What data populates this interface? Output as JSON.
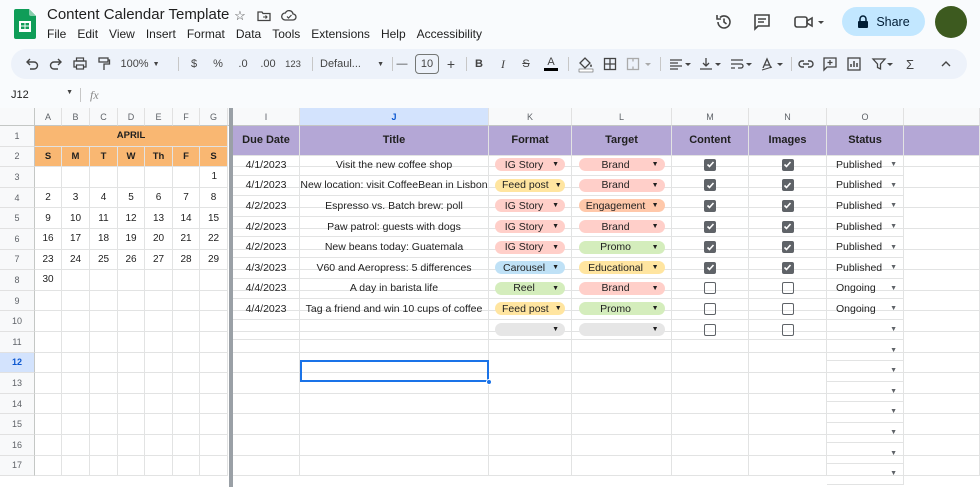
{
  "title": "Content Calendar Template",
  "menu": [
    "File",
    "Edit",
    "View",
    "Insert",
    "Format",
    "Data",
    "Tools",
    "Extensions",
    "Help",
    "Accessibility"
  ],
  "share_label": "Share",
  "toolbar": {
    "zoom": "100%",
    "currency": "$",
    "percent": "%",
    "dec_less": ".0",
    "dec_more": ".00",
    "number_format": "123",
    "font": "Defaul...",
    "font_size": "10",
    "minus": "—",
    "plus": "+",
    "bold": "B",
    "italic": "I",
    "strike": "S",
    "text_color": "A",
    "sigma": "Σ"
  },
  "name_box": "J12",
  "fx": "fx",
  "colors": {
    "calendar_header": "#f9b772",
    "table_header": "#b4a7d6",
    "brand": "#4285f4",
    "share": "#c2e7ff"
  },
  "columns": [
    "A",
    "B",
    "C",
    "D",
    "E",
    "F",
    "G",
    "",
    "I",
    "J",
    "K",
    "L",
    "M",
    "N",
    "O",
    ""
  ],
  "rows": [
    "1",
    "2",
    "3",
    "4",
    "5",
    "6",
    "7",
    "8",
    "9",
    "10",
    "11",
    "12",
    "13",
    "14",
    "15",
    "16",
    "17"
  ],
  "calendar": {
    "month": "APRIL",
    "weekdays": [
      "S",
      "M",
      "T",
      "W",
      "Th",
      "F",
      "S"
    ],
    "weeks": [
      [
        "",
        "",
        "",
        "",
        "",
        "",
        "1"
      ],
      [
        "2",
        "3",
        "4",
        "5",
        "6",
        "7",
        "8"
      ],
      [
        "9",
        "10",
        "11",
        "12",
        "13",
        "14",
        "15"
      ],
      [
        "16",
        "17",
        "18",
        "19",
        "20",
        "21",
        "22"
      ],
      [
        "23",
        "24",
        "25",
        "26",
        "27",
        "28",
        "29"
      ],
      [
        "30",
        "",
        "",
        "",
        "",
        "",
        ""
      ]
    ]
  },
  "table": {
    "headers": [
      "Due Date",
      "Title",
      "Format",
      "Target",
      "Content",
      "Images",
      "Status"
    ],
    "rows": [
      {
        "date": "4/1/2023",
        "title": "Visit the new coffee shop",
        "format": "IG Story",
        "target": "Brand",
        "content": true,
        "images": true,
        "status": "Published"
      },
      {
        "date": "4/1/2023",
        "title": "New location: visit CoffeeBean in Lisbon",
        "format": "Feed post",
        "target": "Brand",
        "content": true,
        "images": true,
        "status": "Published"
      },
      {
        "date": "4/2/2023",
        "title": "Espresso vs. Batch brew: poll",
        "format": "IG Story",
        "target": "Engagement",
        "content": true,
        "images": true,
        "status": "Published"
      },
      {
        "date": "4/2/2023",
        "title": "Paw patrol: guests with dogs",
        "format": "IG Story",
        "target": "Brand",
        "content": true,
        "images": true,
        "status": "Published"
      },
      {
        "date": "4/2/2023",
        "title": "New beans today: Guatemala",
        "format": "IG Story",
        "target": "Promo",
        "content": true,
        "images": true,
        "status": "Published"
      },
      {
        "date": "4/3/2023",
        "title": "V60 and Aeropress: 5 differences",
        "format": "Carousel",
        "target": "Educational",
        "content": true,
        "images": true,
        "status": "Published"
      },
      {
        "date": "4/4/2023",
        "title": "A day in barista life",
        "format": "Reel",
        "target": "Brand",
        "content": false,
        "images": false,
        "status": "Ongoing"
      },
      {
        "date": "4/4/2023",
        "title": "Tag a friend and win 10 cups of coffee",
        "format": "Feed post",
        "target": "Promo",
        "content": false,
        "images": false,
        "status": "Ongoing"
      },
      {
        "date": "",
        "title": "",
        "format": "",
        "target": "",
        "content": false,
        "images": false,
        "status": ""
      }
    ]
  },
  "chip_colors": {
    "IG Story": "#ffcfc9",
    "Feed post": "#ffe5a0",
    "Carousel": "#bfe1f6",
    "Reel": "#d4edbc",
    "Brand": "#ffcfc9",
    "Engagement": "#ffc8aa",
    "Promo": "#d4edbc",
    "Educational": "#ffe5a0",
    "": "#e6e6e6"
  },
  "selected_cell": "J12"
}
